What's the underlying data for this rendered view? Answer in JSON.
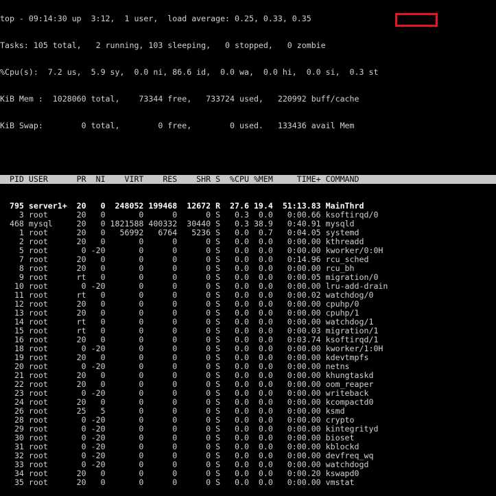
{
  "summary": {
    "top_line": "top - 09:14:30 up  3:12,  1 user,  load average: 0.25, 0.33, 0.35",
    "tasks_line": "Tasks: 105 total,   2 running, 103 sleeping,   0 stopped,   0 zombie",
    "cpu_line": "%Cpu(s):  7.2 us,  5.9 sy,  0.0 ni, 86.6 id,  0.0 wa,  0.0 hi,  0.0 si,  0.3 st",
    "mem_line": "KiB Mem :  1028060 total,    73344 free,   733724 used,   220992 buff/cache",
    "swap_line": "KiB Swap:        0 total,        0 free,        0 used.   133436 avail Mem"
  },
  "process_header": "  PID USER      PR  NI    VIRT    RES    SHR S  %CPU %MEM     TIME+ COMMAND",
  "processes": [
    "  795 server1+  20   0  248052 199468  12672 R  27.6 19.4  51:13.83 MainThrd",
    "    3 root      20   0       0      0      0 S   0.3  0.0   0:00.66 ksoftirqd/0",
    "  468 mysql     20   0 1821588 400332  30440 S   0.3 38.9   0:40.91 mysqld",
    "    1 root      20   0   56992   6764   5236 S   0.0  0.7   0:04.05 systemd",
    "    2 root      20   0       0      0      0 S   0.0  0.0   0:00.00 kthreadd",
    "    5 root       0 -20       0      0      0 S   0.0  0.0   0:00.00 kworker/0:0H",
    "    7 root      20   0       0      0      0 S   0.0  0.0   0:14.96 rcu_sched",
    "    8 root      20   0       0      0      0 S   0.0  0.0   0:00.00 rcu_bh",
    "    9 root      rt   0       0      0      0 S   0.0  0.0   0:00.05 migration/0",
    "   10 root       0 -20       0      0      0 S   0.0  0.0   0:00.00 lru-add-drain",
    "   11 root      rt   0       0      0      0 S   0.0  0.0   0:00.02 watchdog/0",
    "   12 root      20   0       0      0      0 S   0.0  0.0   0:00.00 cpuhp/0",
    "   13 root      20   0       0      0      0 S   0.0  0.0   0:00.00 cpuhp/1",
    "   14 root      rt   0       0      0      0 S   0.0  0.0   0:00.00 watchdog/1",
    "   15 root      rt   0       0      0      0 S   0.0  0.0   0:00.03 migration/1",
    "   16 root      20   0       0      0      0 S   0.0  0.0   0:03.74 ksoftirqd/1",
    "   18 root       0 -20       0      0      0 S   0.0  0.0   0:00.00 kworker/1:0H",
    "   19 root      20   0       0      0      0 S   0.0  0.0   0:00.00 kdevtmpfs",
    "   20 root       0 -20       0      0      0 S   0.0  0.0   0:00.00 netns",
    "   21 root      20   0       0      0      0 S   0.0  0.0   0:00.00 khungtaskd",
    "   22 root      20   0       0      0      0 S   0.0  0.0   0:00.00 oom_reaper",
    "   23 root       0 -20       0      0      0 S   0.0  0.0   0:00.00 writeback",
    "   24 root      20   0       0      0      0 S   0.0  0.0   0:00.00 kcompactd0",
    "   26 root      25   5       0      0      0 S   0.0  0.0   0:00.00 ksmd",
    "   28 root       0 -20       0      0      0 S   0.0  0.0   0:00.00 crypto",
    "   29 root       0 -20       0      0      0 S   0.0  0.0   0:00.00 kintegrityd",
    "   30 root       0 -20       0      0      0 S   0.0  0.0   0:00.00 bioset",
    "   31 root       0 -20       0      0      0 S   0.0  0.0   0:00.00 kblockd",
    "   32 root       0 -20       0      0      0 S   0.0  0.0   0:00.00 devfreq_wq",
    "   33 root       0 -20       0      0      0 S   0.0  0.0   0:00.00 watchdogd",
    "   34 root      20   0       0      0      0 S   0.0  0.0   0:00.20 kswapd0",
    "   35 root      20   0       0      0      0 S   0.0  0.0   0:00.00 vmstat"
  ],
  "highlight": {
    "label": "0.3 st",
    "color": "#e3161f"
  },
  "colors": {
    "background": "#000000",
    "foreground": "#d2d2d2",
    "header_bg": "#c8c8c8",
    "running_fg": "#ffffff"
  }
}
